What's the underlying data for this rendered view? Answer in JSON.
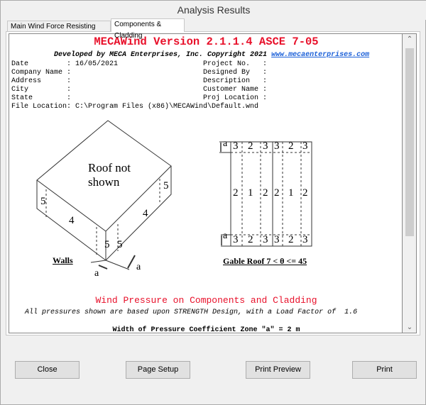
{
  "window": {
    "title": "Analysis Results"
  },
  "tabs": [
    {
      "label": "Main Wind Force Resisting System"
    },
    {
      "label": "Components & Cladding"
    }
  ],
  "report": {
    "heading": "MECAWind Version 2.1.1.4 ASCE 7-05",
    "developed": "Developed by MECA Enterprises, Inc. Copyright 2021 ",
    "url": "www.mecaenterprises.com",
    "left_fields": [
      "Date         : 16/05/2021",
      "Company Name :",
      "Address      :",
      "City         :",
      "State        :"
    ],
    "right_fields": [
      "Project No.   :",
      "Designed By   :",
      "Description   :",
      "Customer Name :",
      "Proj Location :"
    ],
    "file_location": "File Location: C:\\Program Files (x86)\\MECAWind\\Default.wnd",
    "walls_diagram": {
      "roof_label_1": "Roof not",
      "roof_label_2": "shown",
      "caption": "Walls",
      "zones": [
        "5",
        "4",
        "5",
        "5",
        "4",
        "5"
      ],
      "dim": "a"
    },
    "roof_diagram": {
      "caption": "Gable Roof 7 < θ <= 45",
      "top_row": [
        "3",
        "2",
        "3",
        "3",
        "2",
        "3"
      ],
      "mid_row": [
        "2",
        "1",
        "2",
        "2",
        "1",
        "2"
      ],
      "bottom_row": [
        "3",
        "2",
        "3",
        "3",
        "2",
        "3"
      ],
      "dim": "a"
    },
    "section_title": "Wind Pressure on Components and Cladding",
    "note": "All pressures shown are based upon STRENGTH Design, with a Load Factor of  1.6",
    "zone_width": "Width of Pressure Coefficient Zone \"a\" = 2 m"
  },
  "buttons": {
    "close": "Close",
    "page_setup": "Page Setup",
    "print_preview": "Print Preview",
    "print": "Print"
  }
}
